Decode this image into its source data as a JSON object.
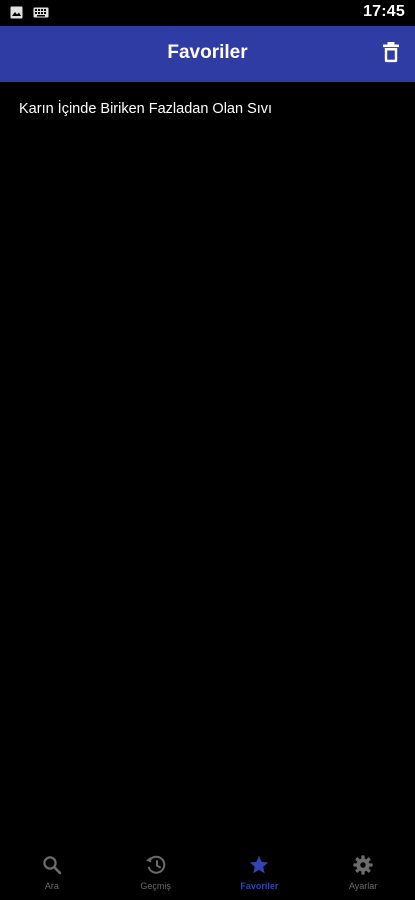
{
  "status_bar": {
    "time": "17:45",
    "icons": [
      "image-notification-icon",
      "keyboard-icon"
    ]
  },
  "header": {
    "title": "Favoriler",
    "action_icon": "trash-icon"
  },
  "favorites": [
    {
      "label": "Karın İçinde Biriken Fazladan Olan Sıvı"
    }
  ],
  "bottom_nav": {
    "items": [
      {
        "label": "Ara",
        "icon": "search-icon"
      },
      {
        "label": "Geçmiş",
        "icon": "history-icon"
      },
      {
        "label": "Favoriler",
        "icon": "star-icon"
      },
      {
        "label": "Ayarlar",
        "icon": "settings-icon"
      }
    ],
    "active_label": "Favoriler"
  },
  "colors": {
    "primary": "#2f3ca4",
    "active_nav": "#3544b4",
    "inactive_nav": "#6b6b6b",
    "background": "#000000",
    "text": "#ffffff"
  }
}
